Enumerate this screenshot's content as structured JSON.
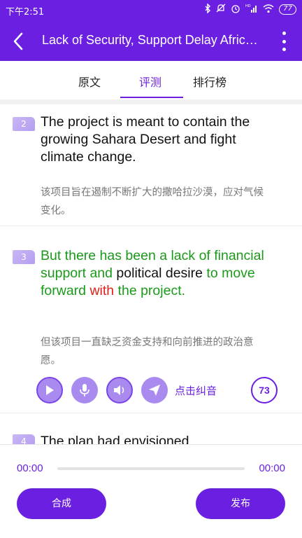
{
  "status_bar": {
    "time": "下午2:51",
    "battery": "77",
    "network_label": "HD"
  },
  "app_bar": {
    "title": "Lack of Security, Support Delay African Great Green Wall Project"
  },
  "tabs": [
    {
      "label": "原文",
      "active": false
    },
    {
      "label": "评测",
      "active": true
    },
    {
      "label": "排行榜",
      "active": false
    }
  ],
  "sentences": [
    {
      "number": "2",
      "english_segments": [
        {
          "text": "The project is meant to contain the growing Sahara Desert and fight climate change.",
          "status": "normal"
        }
      ],
      "chinese": "该项目旨在遏制不断扩大的撒哈拉沙漠，应对气候变化。"
    },
    {
      "number": "3",
      "english_segments": [
        {
          "text": "But there has been a lack of financial support and ",
          "status": "correct"
        },
        {
          "text": "political desire ",
          "status": "normal"
        },
        {
          "text": "to move forward ",
          "status": "correct"
        },
        {
          "text": "with",
          "status": "wrong"
        },
        {
          "text": " the project.",
          "status": "correct"
        }
      ],
      "chinese": "但该项目一直缺乏资金支持和向前推进的政治意愿。",
      "correct_label": "点击纠音",
      "score": "73"
    },
    {
      "number": "4",
      "english_segments": [
        {
          "text": "The plan had envisioned",
          "status": "normal"
        }
      ]
    }
  ],
  "player": {
    "current_time": "00:00",
    "total_time": "00:00",
    "progress": 0
  },
  "buttons": {
    "synthesize": "合成",
    "publish": "发布"
  },
  "colors": {
    "accent": "#6b1fe0",
    "correct": "#1a9a1a",
    "wrong": "#e0201a"
  }
}
